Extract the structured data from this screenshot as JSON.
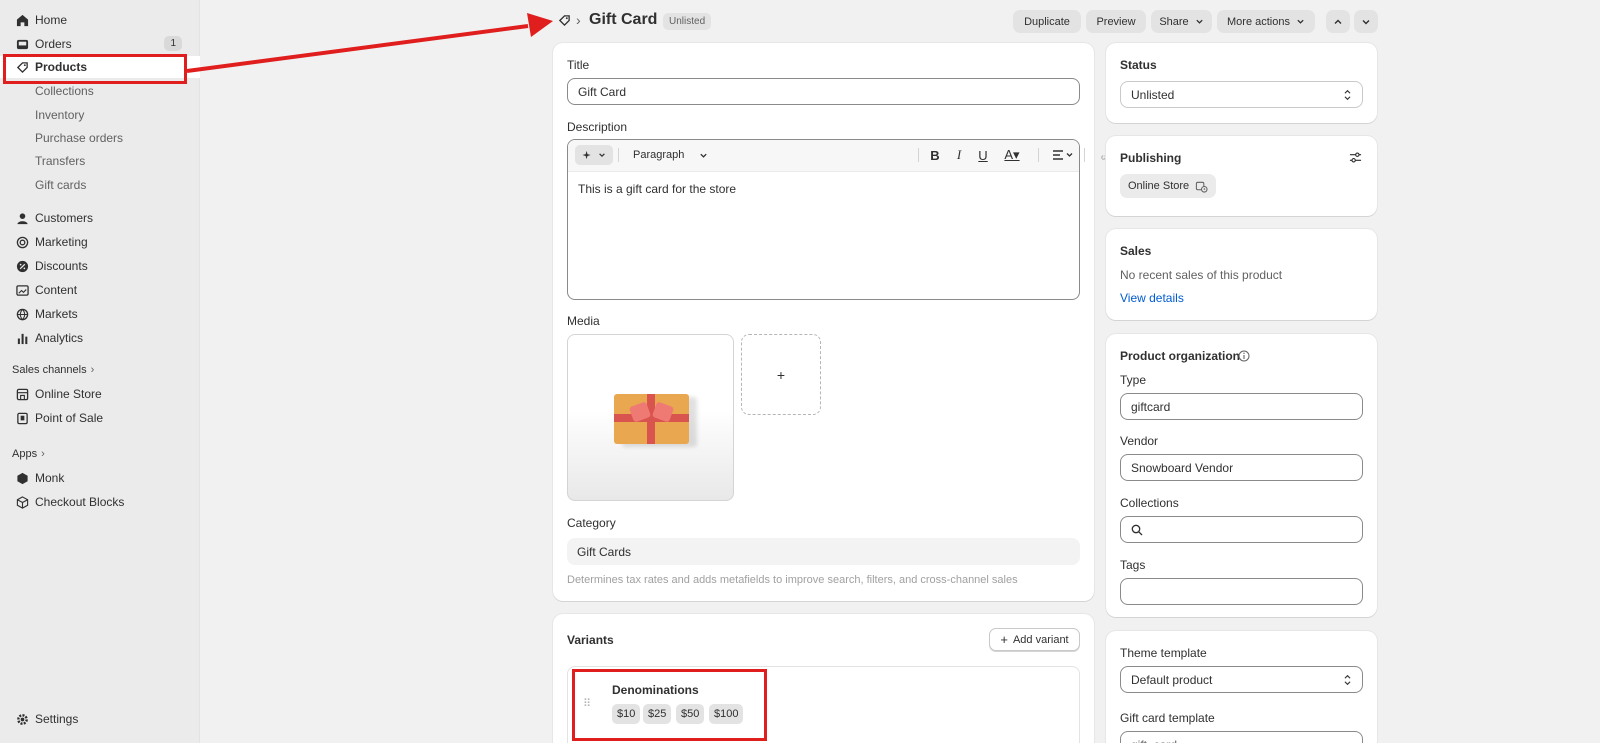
{
  "sidebar": {
    "home": "Home",
    "orders": "Orders",
    "orders_badge": "1",
    "products": "Products",
    "collections": "Collections",
    "inventory": "Inventory",
    "purchase_orders": "Purchase orders",
    "transfers": "Transfers",
    "gift_cards": "Gift cards",
    "customers": "Customers",
    "marketing": "Marketing",
    "discounts": "Discounts",
    "content": "Content",
    "markets": "Markets",
    "analytics": "Analytics",
    "sales_channels": "Sales channels",
    "online_store": "Online Store",
    "point_of_sale": "Point of Sale",
    "apps": "Apps",
    "monk": "Monk",
    "checkout_blocks": "Checkout Blocks",
    "settings": "Settings"
  },
  "header": {
    "title": "Gift Card",
    "status_badge": "Unlisted",
    "duplicate": "Duplicate",
    "preview": "Preview",
    "share": "Share",
    "more_actions": "More actions"
  },
  "product": {
    "title_label": "Title",
    "title_value": "Gift Card",
    "description_label": "Description",
    "paragraph": "Paragraph",
    "description_text": "This is a gift card for the store",
    "media_label": "Media",
    "add_media": "+",
    "category_label": "Category",
    "category_value": "Gift Cards",
    "category_help": "Determines tax rates and adds metafields to improve search, filters, and cross-channel sales"
  },
  "variants": {
    "title": "Variants",
    "add_variant": "Add variant",
    "option_name": "Denominations",
    "values": [
      "$10",
      "$25",
      "$50",
      "$100"
    ]
  },
  "status": {
    "label": "Status",
    "value": "Unlisted"
  },
  "publishing": {
    "label": "Publishing",
    "channel": "Online Store"
  },
  "sales": {
    "label": "Sales",
    "text": "No recent sales of this product",
    "link": "View details"
  },
  "organization": {
    "label": "Product organization",
    "type_label": "Type",
    "type_value": "giftcard",
    "vendor_label": "Vendor",
    "vendor_value": "Snowboard Vendor",
    "collections_label": "Collections",
    "tags_label": "Tags"
  },
  "theme": {
    "label": "Theme template",
    "value": "Default product",
    "gift_label": "Gift card template",
    "gift_value": "gift_card"
  },
  "colors": {
    "highlight": "#e01e1e",
    "link": "#005bd3",
    "sidebar_bg": "#ebebeb",
    "main_bg": "#f1f1f1"
  }
}
